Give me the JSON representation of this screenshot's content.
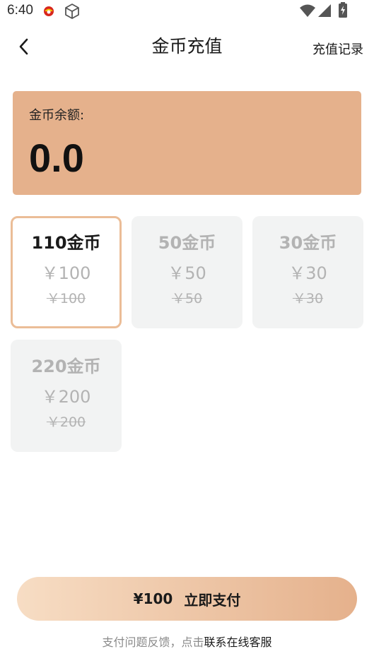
{
  "status_bar": {
    "time": "6:40",
    "icons": [
      "app-notification-icon",
      "cube-icon",
      "wifi-icon",
      "signal-icon",
      "battery-icon"
    ]
  },
  "header": {
    "back_icon": "chevron-left-icon",
    "title": "金币充值",
    "history_label": "充值记录"
  },
  "balance": {
    "label": "金币余额:",
    "value": "0.0"
  },
  "packages": [
    {
      "coins": "110金币",
      "price": "￥100",
      "original_price": "￥100",
      "selected": true
    },
    {
      "coins": "50金币",
      "price": "￥50",
      "original_price": "￥50",
      "selected": false
    },
    {
      "coins": "30金币",
      "price": "￥30",
      "original_price": "￥30",
      "selected": false
    },
    {
      "coins": "220金币",
      "price": "￥200",
      "original_price": "￥200",
      "selected": false
    }
  ],
  "pay_button": {
    "price": "¥100",
    "label": "立即支付"
  },
  "footer": {
    "text": "支付问题反馈，点击",
    "link": "联系在线客服"
  },
  "colors": {
    "accent": "#e5b18c",
    "selected_border": "#ebbd97",
    "card_bg": "#f2f3f3",
    "muted_text": "#b3b3b3"
  }
}
